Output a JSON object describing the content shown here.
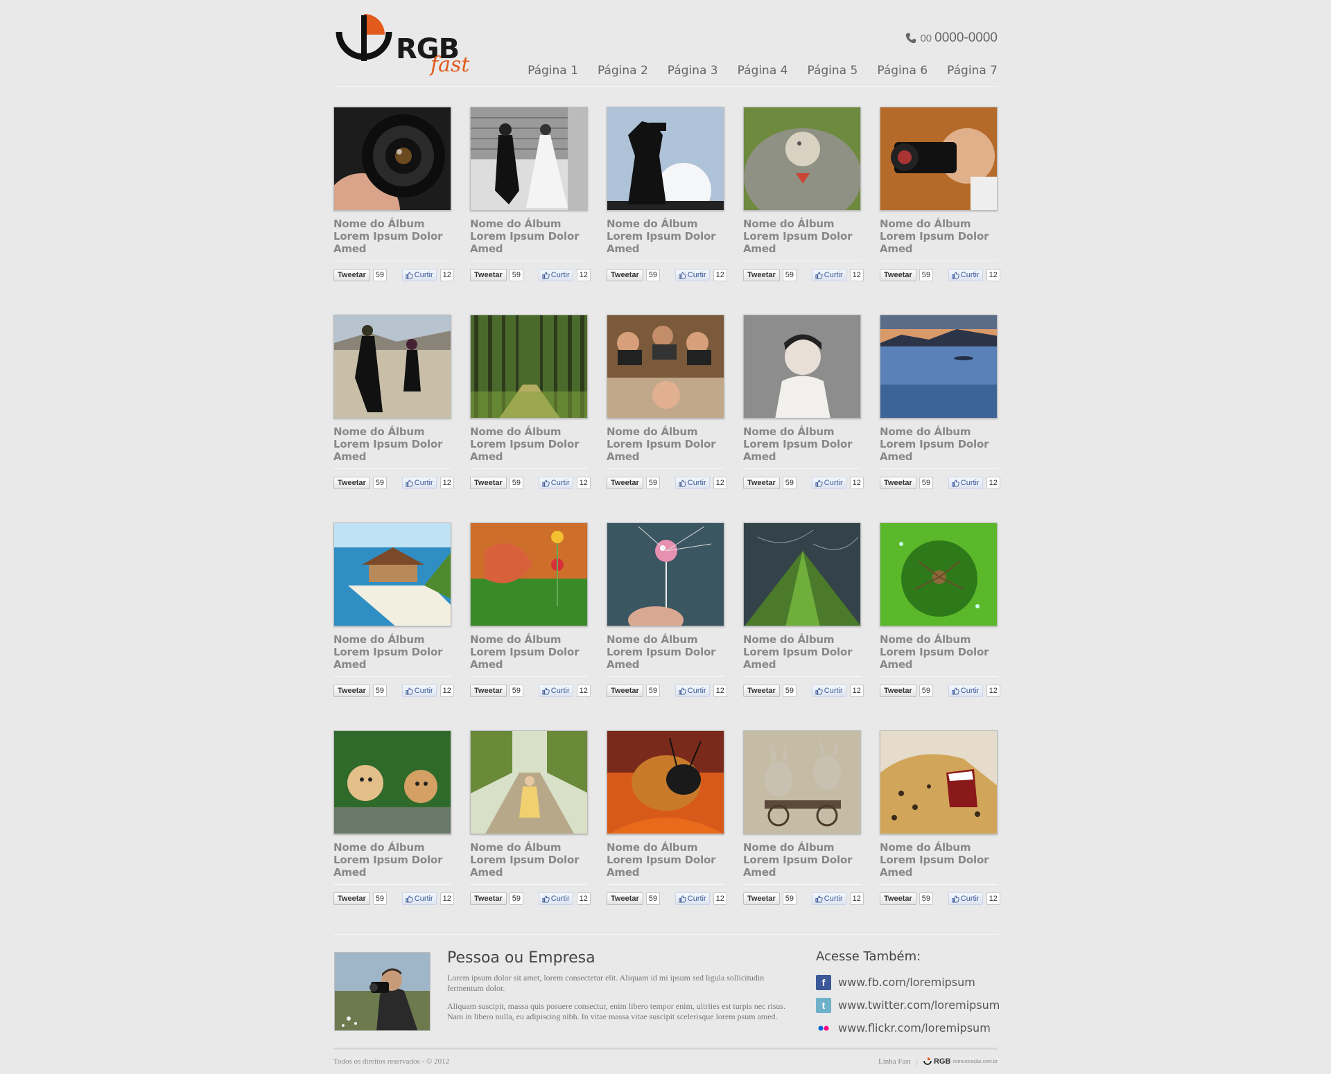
{
  "header": {
    "logo_main": "RGB",
    "logo_sub": "fast",
    "phone_code": "00",
    "phone_number": "0000-0000",
    "nav": [
      "Página 1",
      "Página 2",
      "Página 3",
      "Página 4",
      "Página 5",
      "Página 6",
      "Página 7"
    ]
  },
  "album_title": "Nome do Álbum Lorem Ipsum Dolor Amed",
  "tweet_label": "Tweetar",
  "tweet_count": "59",
  "like_label": "Curtir",
  "like_count": "12",
  "albums": [
    {
      "image": "camera-lens"
    },
    {
      "image": "wedding-couple"
    },
    {
      "image": "photographer-silhouette"
    },
    {
      "image": "bird-closeup"
    },
    {
      "image": "man-with-camera"
    },
    {
      "image": "dancing-couple"
    },
    {
      "image": "forest-path"
    },
    {
      "image": "photographers-crowd"
    },
    {
      "image": "bride-portrait"
    },
    {
      "image": "sea-sunset"
    },
    {
      "image": "island-hut"
    },
    {
      "image": "flower-drops"
    },
    {
      "image": "water-drop-dandelion"
    },
    {
      "image": "green-mountain"
    },
    {
      "image": "spider-leaf"
    },
    {
      "image": "puppies"
    },
    {
      "image": "girl-orchard"
    },
    {
      "image": "bee-closeup"
    },
    {
      "image": "rabbits-cart"
    },
    {
      "image": "cheetah-roar"
    }
  ],
  "footer": {
    "name": "Pessoa ou Empresa",
    "paragraph1": "Lorem ipsum dolor sit amet, lorem consectetur elit. Aliquam id mi ipsum sed ligula sollicitudin fermentum dolor.",
    "paragraph2": "Aliquam suscipit, massa quis posuere consectur, enim libero tempor enim, ultriies est turpis nec risus. Nam in libero nulla, eu adipiscing nibh.  In vitae massa vitae suscipit scelerisque lorem psum amed.",
    "also_title": "Acesse Também:",
    "links": [
      {
        "icon": "facebook-icon",
        "text": "www.fb.com/loremipsum"
      },
      {
        "icon": "twitter-icon",
        "text": "www.twitter.com/loremipsum"
      },
      {
        "icon": "flickr-icon",
        "text": "www.flickr.com/loremipsum"
      }
    ],
    "copyright": "Todos os direitos reservados - © 2012",
    "line_label": "Linha Fast",
    "credit_brand": "RGB",
    "credit_domain": "comunicação.com.br"
  },
  "colors": {
    "accent": "#e25a1c",
    "facebook": "#3b5998",
    "twitter": "#55acee"
  }
}
